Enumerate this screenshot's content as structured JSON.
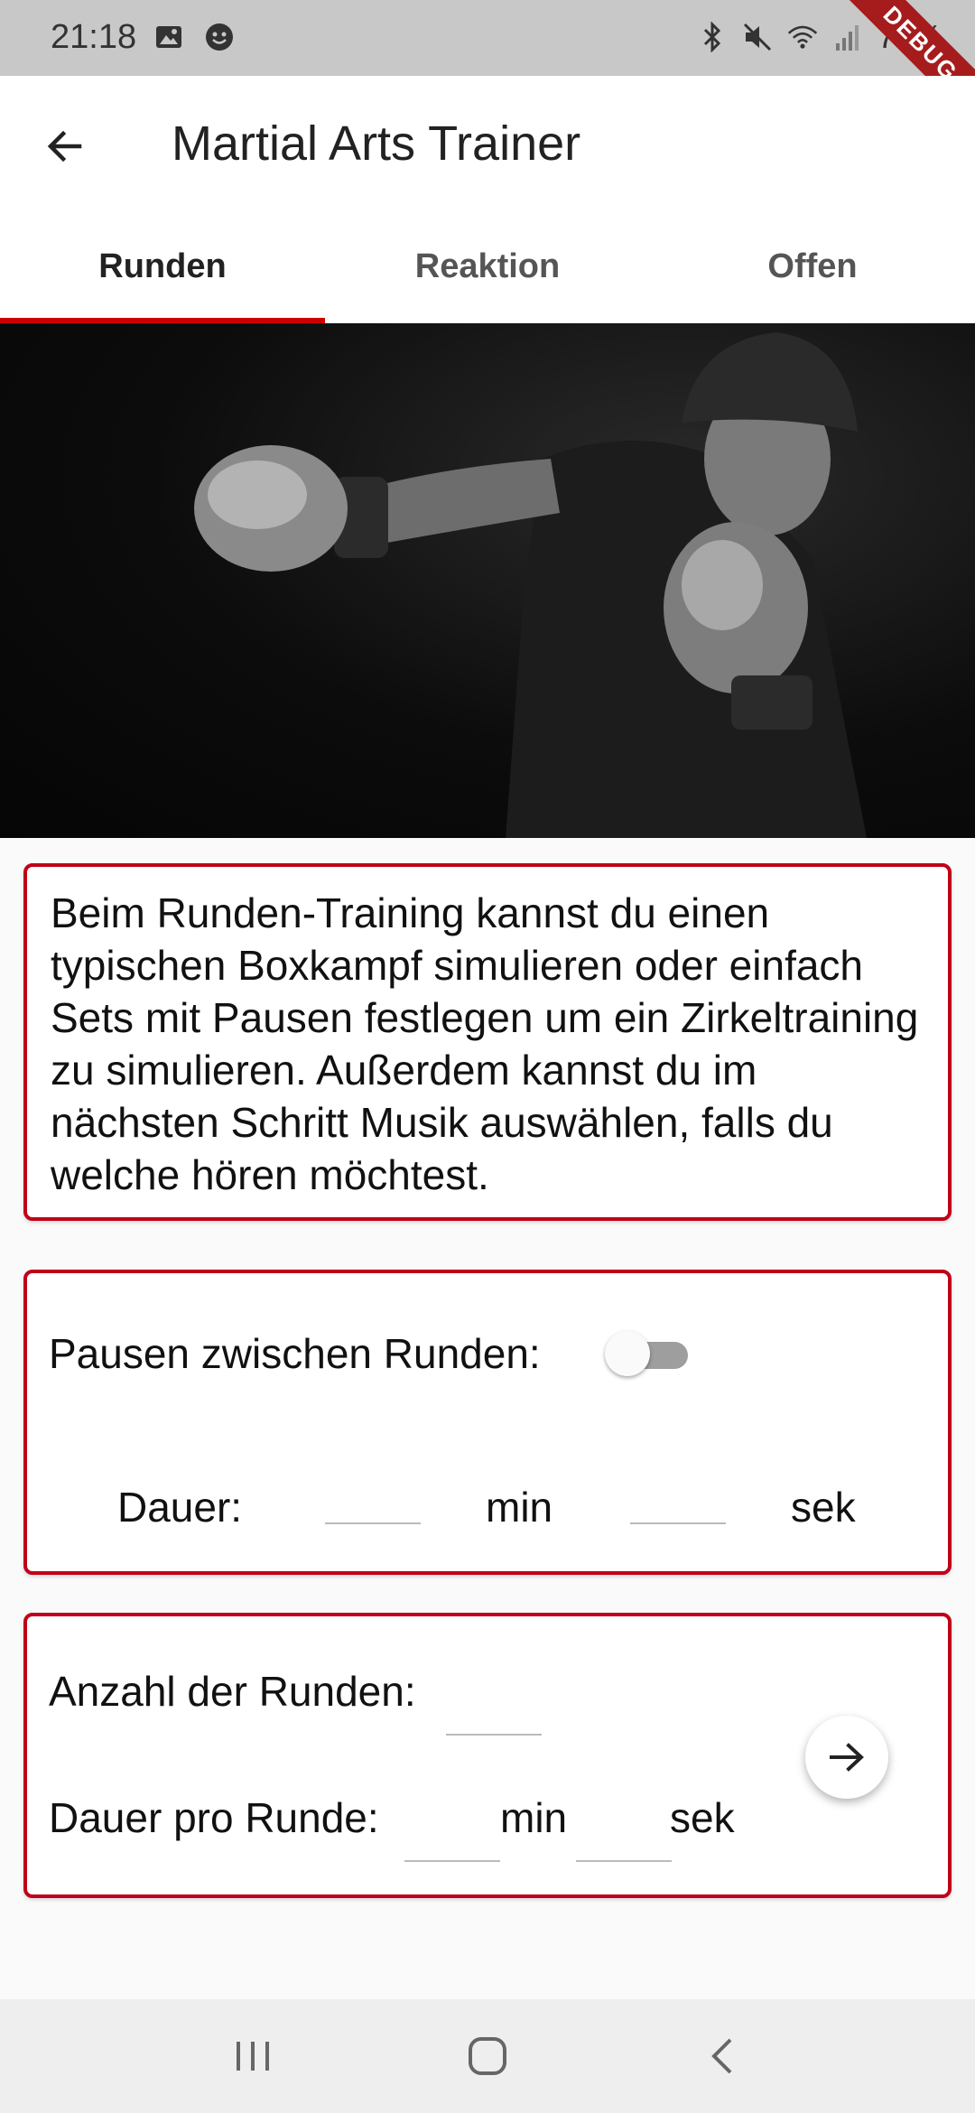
{
  "status_bar": {
    "time": "21:18",
    "battery": "70%",
    "debug_label": "DEBUG",
    "icons": [
      "image-icon",
      "emoji-icon",
      "bluetooth-icon",
      "mute-icon",
      "wifi-icon",
      "signal-icon"
    ]
  },
  "app_bar": {
    "title": "Martial Arts Trainer",
    "back_icon": "arrow-left-icon"
  },
  "tabs": [
    {
      "label": "Runden",
      "active": true
    },
    {
      "label": "Reaktion",
      "active": false
    },
    {
      "label": "Offen",
      "active": false
    }
  ],
  "description": "Beim Runden-Training kannst du einen typischen Boxkampf simulieren oder einfach Sets mit Pausen festlegen um ein Zirkeltraining zu simulieren. Außerdem kannst du im nächsten Schritt Musik auswählen, falls du welche hören möchtest.",
  "pause_card": {
    "label": "Pausen zwischen Runden:",
    "toggle_on": false,
    "dauer_label": "Dauer:",
    "min_label": "min",
    "sek_label": "sek",
    "min_value": "",
    "sek_value": ""
  },
  "rounds_card": {
    "rounds_label": "Anzahl der Runden:",
    "rounds_value": "",
    "duration_label": "Dauer pro Runde:",
    "min_label": "min",
    "sek_label": "sek",
    "min_value": "",
    "sek_value": "",
    "next_icon": "arrow-right-icon"
  },
  "colors": {
    "accent": "#c0001a",
    "tab_indicator": "#cc0000",
    "status_bar": "#c8c8c8"
  },
  "nav_bar": {
    "icons": [
      "recents-icon",
      "home-icon",
      "back-icon"
    ]
  }
}
